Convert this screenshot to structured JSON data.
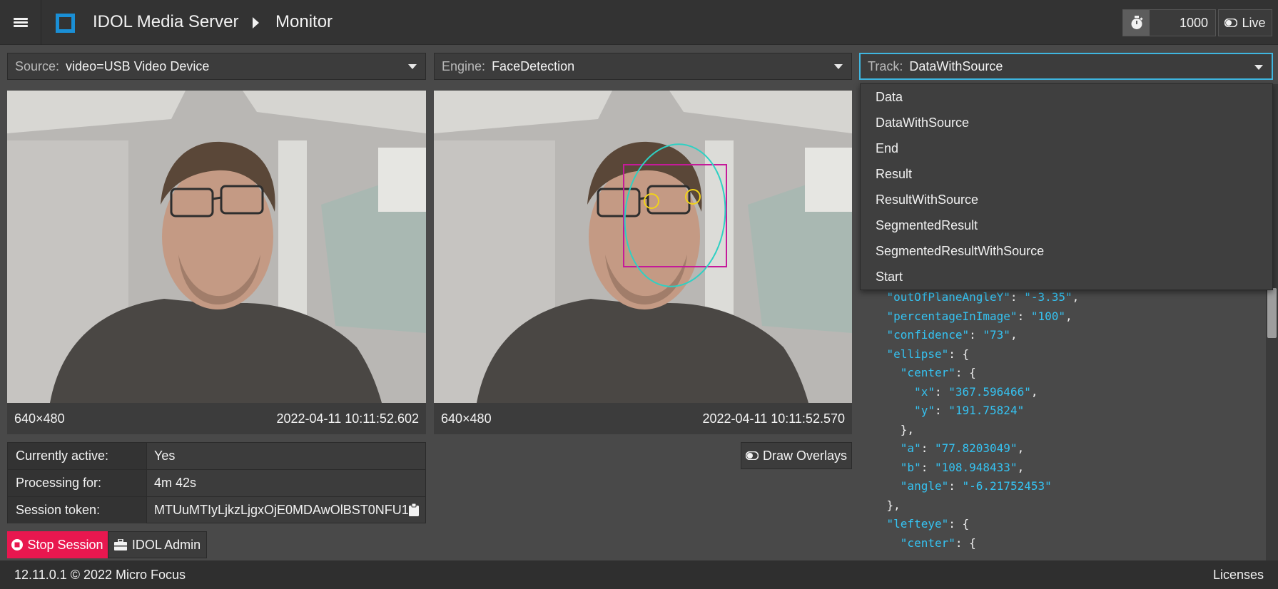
{
  "header": {
    "app_title": "IDOL Media Server",
    "page_title": "Monitor",
    "frame_rate": "1000",
    "live_label": "Live"
  },
  "selectors": {
    "source": {
      "label": "Source:",
      "value": "video=USB Video Device"
    },
    "engine": {
      "label": "Engine:",
      "value": "FaceDetection"
    },
    "track": {
      "label": "Track:",
      "value": "DataWithSource"
    }
  },
  "track_options": [
    "Data",
    "DataWithSource",
    "End",
    "Result",
    "ResultWithSource",
    "SegmentedResult",
    "SegmentedResultWithSource",
    "Start"
  ],
  "video_left": {
    "resolution": "640×480",
    "timestamp": "2022-04-11 10:11:52.602"
  },
  "video_right": {
    "resolution": "640×480",
    "timestamp": "2022-04-11 10:11:52.570"
  },
  "session": {
    "active_label": "Currently active:",
    "active_value": "Yes",
    "processing_label": "Processing for:",
    "processing_value": "4m 42s",
    "token_label": "Session token:",
    "token_value": "MTUuMTIyLjkzLjgxOjE0MDAwOlBST0NFU1..."
  },
  "buttons": {
    "stop_session": "Stop Session",
    "idol_admin": "IDOL Admin",
    "draw_overlays": "Draw Overlays"
  },
  "json_output": {
    "outOfPlaneAngleY": "-3.35",
    "percentageInImage": "100",
    "confidence": "73",
    "ellipse_center_x": "367.596466",
    "ellipse_center_y": "191.75824",
    "ellipse_a": "77.8203049",
    "ellipse_b": "108.948433",
    "ellipse_angle": "-6.21752453"
  },
  "footer": {
    "version": "12.11.0.1 © 2022 Micro Focus",
    "licenses": "Licenses"
  },
  "colors": {
    "accent": "#3fb6e0",
    "stop_button": "#e8174f",
    "json_key": "#35c3f2",
    "face_box": "#c51a9a",
    "face_ellipse": "#2fd0c3",
    "eye_marker": "#f1d21a"
  }
}
